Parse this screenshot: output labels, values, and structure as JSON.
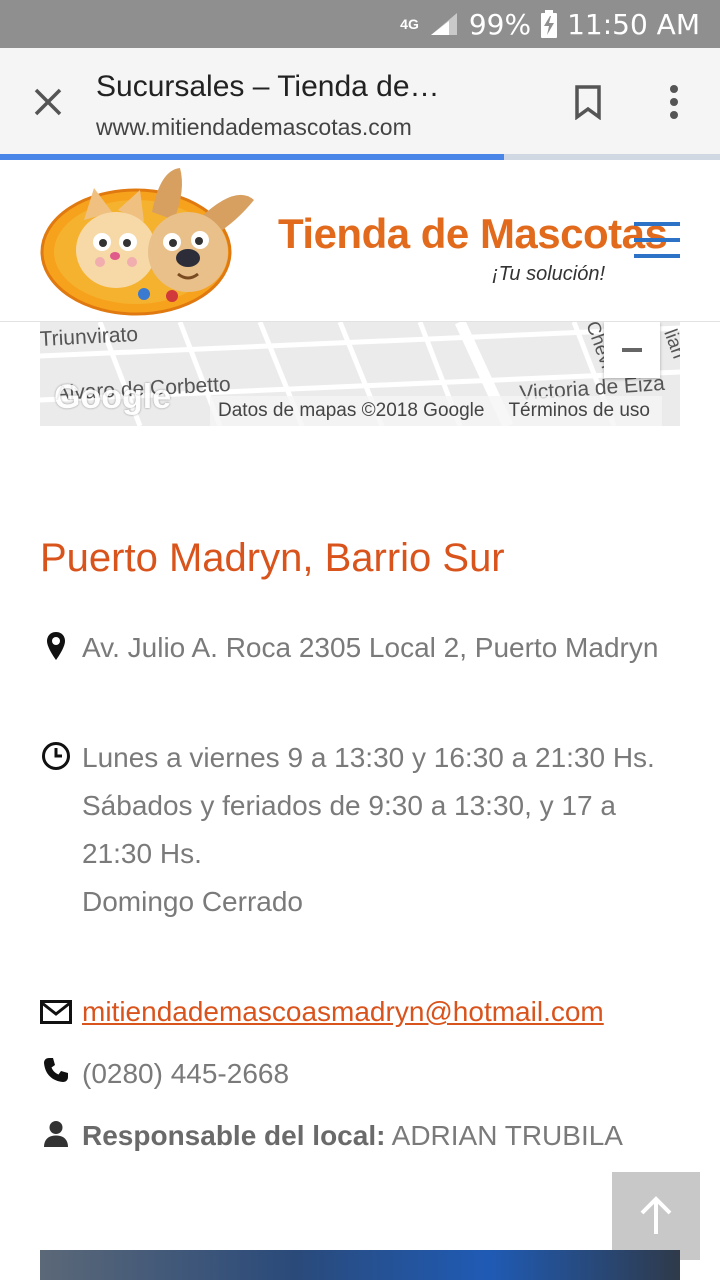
{
  "status_bar": {
    "network": "4G",
    "battery": "99%",
    "time": "11:50 AM"
  },
  "browser": {
    "title": "Sucursales – Tienda de…",
    "url": "www.mitiendademascotas.com",
    "page_load_progress": 0.7,
    "icons": {
      "close": "close-icon",
      "bookmark": "bookmark-icon",
      "menu": "more-vert-icon"
    }
  },
  "site": {
    "brand_name": "Tienda de Mascotas",
    "tagline": "¡Tu solución!",
    "accent_color": "#e26a1c",
    "menu_color": "#2c72c7"
  },
  "map": {
    "street_labels": [
      "Triunvirato",
      "Alvaro de Corbetto",
      "Victoria de Eiza",
      "Chevi",
      "lian"
    ],
    "google_logo": "Google",
    "attribution": "Datos de mapas ©2018 Google",
    "terms": "Términos de uso"
  },
  "branch": {
    "name": "Puerto Madryn, Barrio Sur",
    "address": "Av. Julio A. Roca 2305 Local 2, Puerto Madryn",
    "hours": [
      "Lunes a viernes 9 a 13:30 y 16:30 a 21:30 Hs.",
      "Sábados y feriados de 9:30 a 13:30, y 17 a 21:30 Hs.",
      "Domingo Cerrado"
    ],
    "email": "mitiendademascoasmadryn@hotmail.com",
    "phone": "(0280) 445-2668",
    "manager_label": "Responsable del local:",
    "manager_name": "ADRIAN TRUBILA",
    "link_color": "#d9541c"
  }
}
